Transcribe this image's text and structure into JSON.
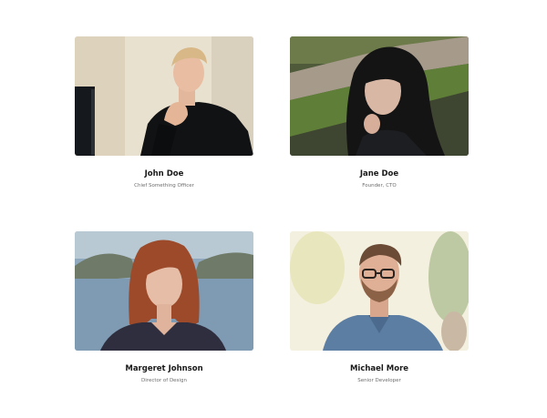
{
  "team": {
    "members": [
      {
        "name": "John Doe",
        "role": "Chief Something Officer"
      },
      {
        "name": "Jane Doe",
        "role": "Founder, CTO"
      },
      {
        "name": "Margeret Johnson",
        "role": "Director of Design"
      },
      {
        "name": "Michael More",
        "role": "Senior Developer"
      }
    ]
  },
  "colors": {
    "name_text": "#1a1a1a",
    "role_text": "#6d6d6d",
    "background": "#ffffff"
  }
}
